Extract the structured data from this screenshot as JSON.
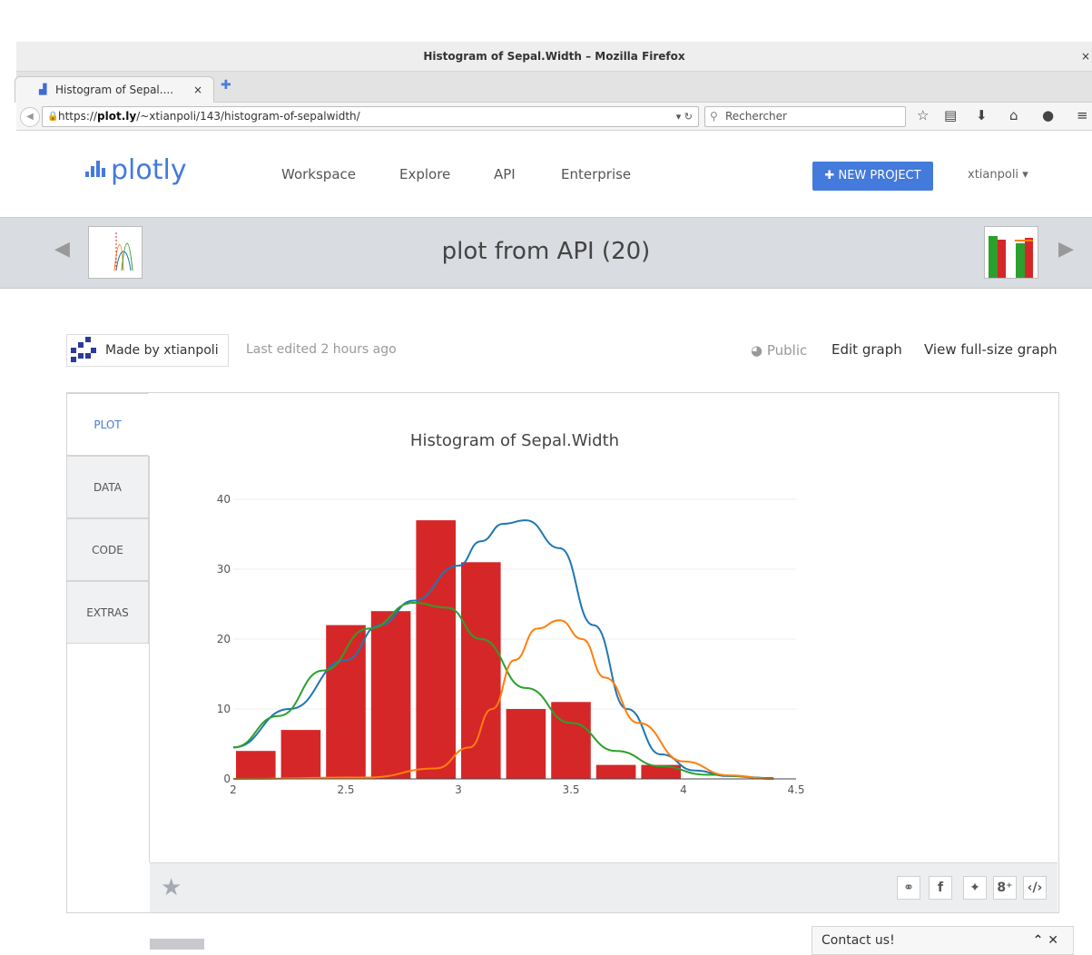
{
  "browser": {
    "window_title": "Histogram of Sepal.Width – Mozilla Firefox",
    "close_glyph": "×",
    "tab_label": "Histogram of Sepal....",
    "tab_close": "×",
    "url_prefix": "https://",
    "url_domain": "plot.ly",
    "url_path": "/~xtianpoli/143/histogram-of-sepalwidth/",
    "search_placeholder": "Rechercher"
  },
  "header": {
    "logo_text": "plotly",
    "nav": [
      "Workspace",
      "Explore",
      "API",
      "Enterprise"
    ],
    "new_project": "NEW PROJECT",
    "user": "xtianpoli"
  },
  "banner": {
    "title": "plot from API (20)"
  },
  "meta": {
    "made_by": "Made by xtianpoli",
    "last_edited": "Last edited 2 hours ago",
    "visibility": "Public",
    "edit_graph": "Edit graph",
    "view_full": "View full-size graph"
  },
  "tabs": [
    "PLOT",
    "DATA",
    "CODE",
    "EXTRAS"
  ],
  "contact": {
    "label": "Contact us!"
  },
  "colors": {
    "accent": "#447adb",
    "bar": "#d62728",
    "line_blue": "#1f77b4",
    "line_orange": "#ff7f0e",
    "line_green": "#2ca02c"
  },
  "chart_data": {
    "type": "bar",
    "title": "Histogram of Sepal.Width",
    "xlabel": "",
    "ylabel": "",
    "xlim": [
      2,
      4.5
    ],
    "ylim": [
      0,
      40
    ],
    "x_ticks": [
      "2",
      "2.5",
      "3",
      "3.5",
      "4",
      "4.5"
    ],
    "y_ticks": [
      "0",
      "10",
      "20",
      "30",
      "40"
    ],
    "grid": true,
    "bars": [
      {
        "x0": 2.0,
        "x1": 2.2,
        "value": 4
      },
      {
        "x0": 2.2,
        "x1": 2.4,
        "value": 7
      },
      {
        "x0": 2.4,
        "x1": 2.6,
        "value": 22
      },
      {
        "x0": 2.6,
        "x1": 2.8,
        "value": 24
      },
      {
        "x0": 2.8,
        "x1": 3.0,
        "value": 37
      },
      {
        "x0": 3.0,
        "x1": 3.2,
        "value": 31
      },
      {
        "x0": 3.2,
        "x1": 3.4,
        "value": 10
      },
      {
        "x0": 3.4,
        "x1": 3.6,
        "value": 11
      },
      {
        "x0": 3.6,
        "x1": 3.8,
        "value": 2
      },
      {
        "x0": 3.8,
        "x1": 4.0,
        "value": 2
      }
    ],
    "lines": [
      {
        "color": "#1f77b4",
        "x": [
          2.0,
          2.25,
          2.5,
          2.65,
          2.8,
          3.0,
          3.1,
          3.2,
          3.3,
          3.45,
          3.6,
          3.75,
          3.9,
          4.05,
          4.2,
          4.4
        ],
        "y": [
          4.5,
          10,
          17,
          22,
          25.5,
          30.5,
          34,
          36.5,
          37,
          33,
          22,
          10,
          3.5,
          1.2,
          0.4,
          0.1
        ]
      },
      {
        "color": "#2ca02c",
        "x": [
          2.0,
          2.2,
          2.4,
          2.6,
          2.8,
          2.95,
          3.1,
          3.3,
          3.5,
          3.7,
          3.9,
          4.1,
          4.4
        ],
        "y": [
          4.5,
          9,
          15.5,
          21.5,
          25.2,
          24.5,
          20,
          13,
          8,
          4,
          1.8,
          0.6,
          0.1
        ]
      },
      {
        "color": "#ff7f0e",
        "x": [
          2.0,
          2.6,
          2.9,
          3.05,
          3.15,
          3.25,
          3.35,
          3.45,
          3.55,
          3.65,
          3.8,
          4.0,
          4.2,
          4.4
        ],
        "y": [
          0,
          0.2,
          1.5,
          4.5,
          10,
          17,
          21.5,
          22.7,
          20,
          14.5,
          8,
          2.5,
          0.5,
          0
        ]
      }
    ]
  }
}
